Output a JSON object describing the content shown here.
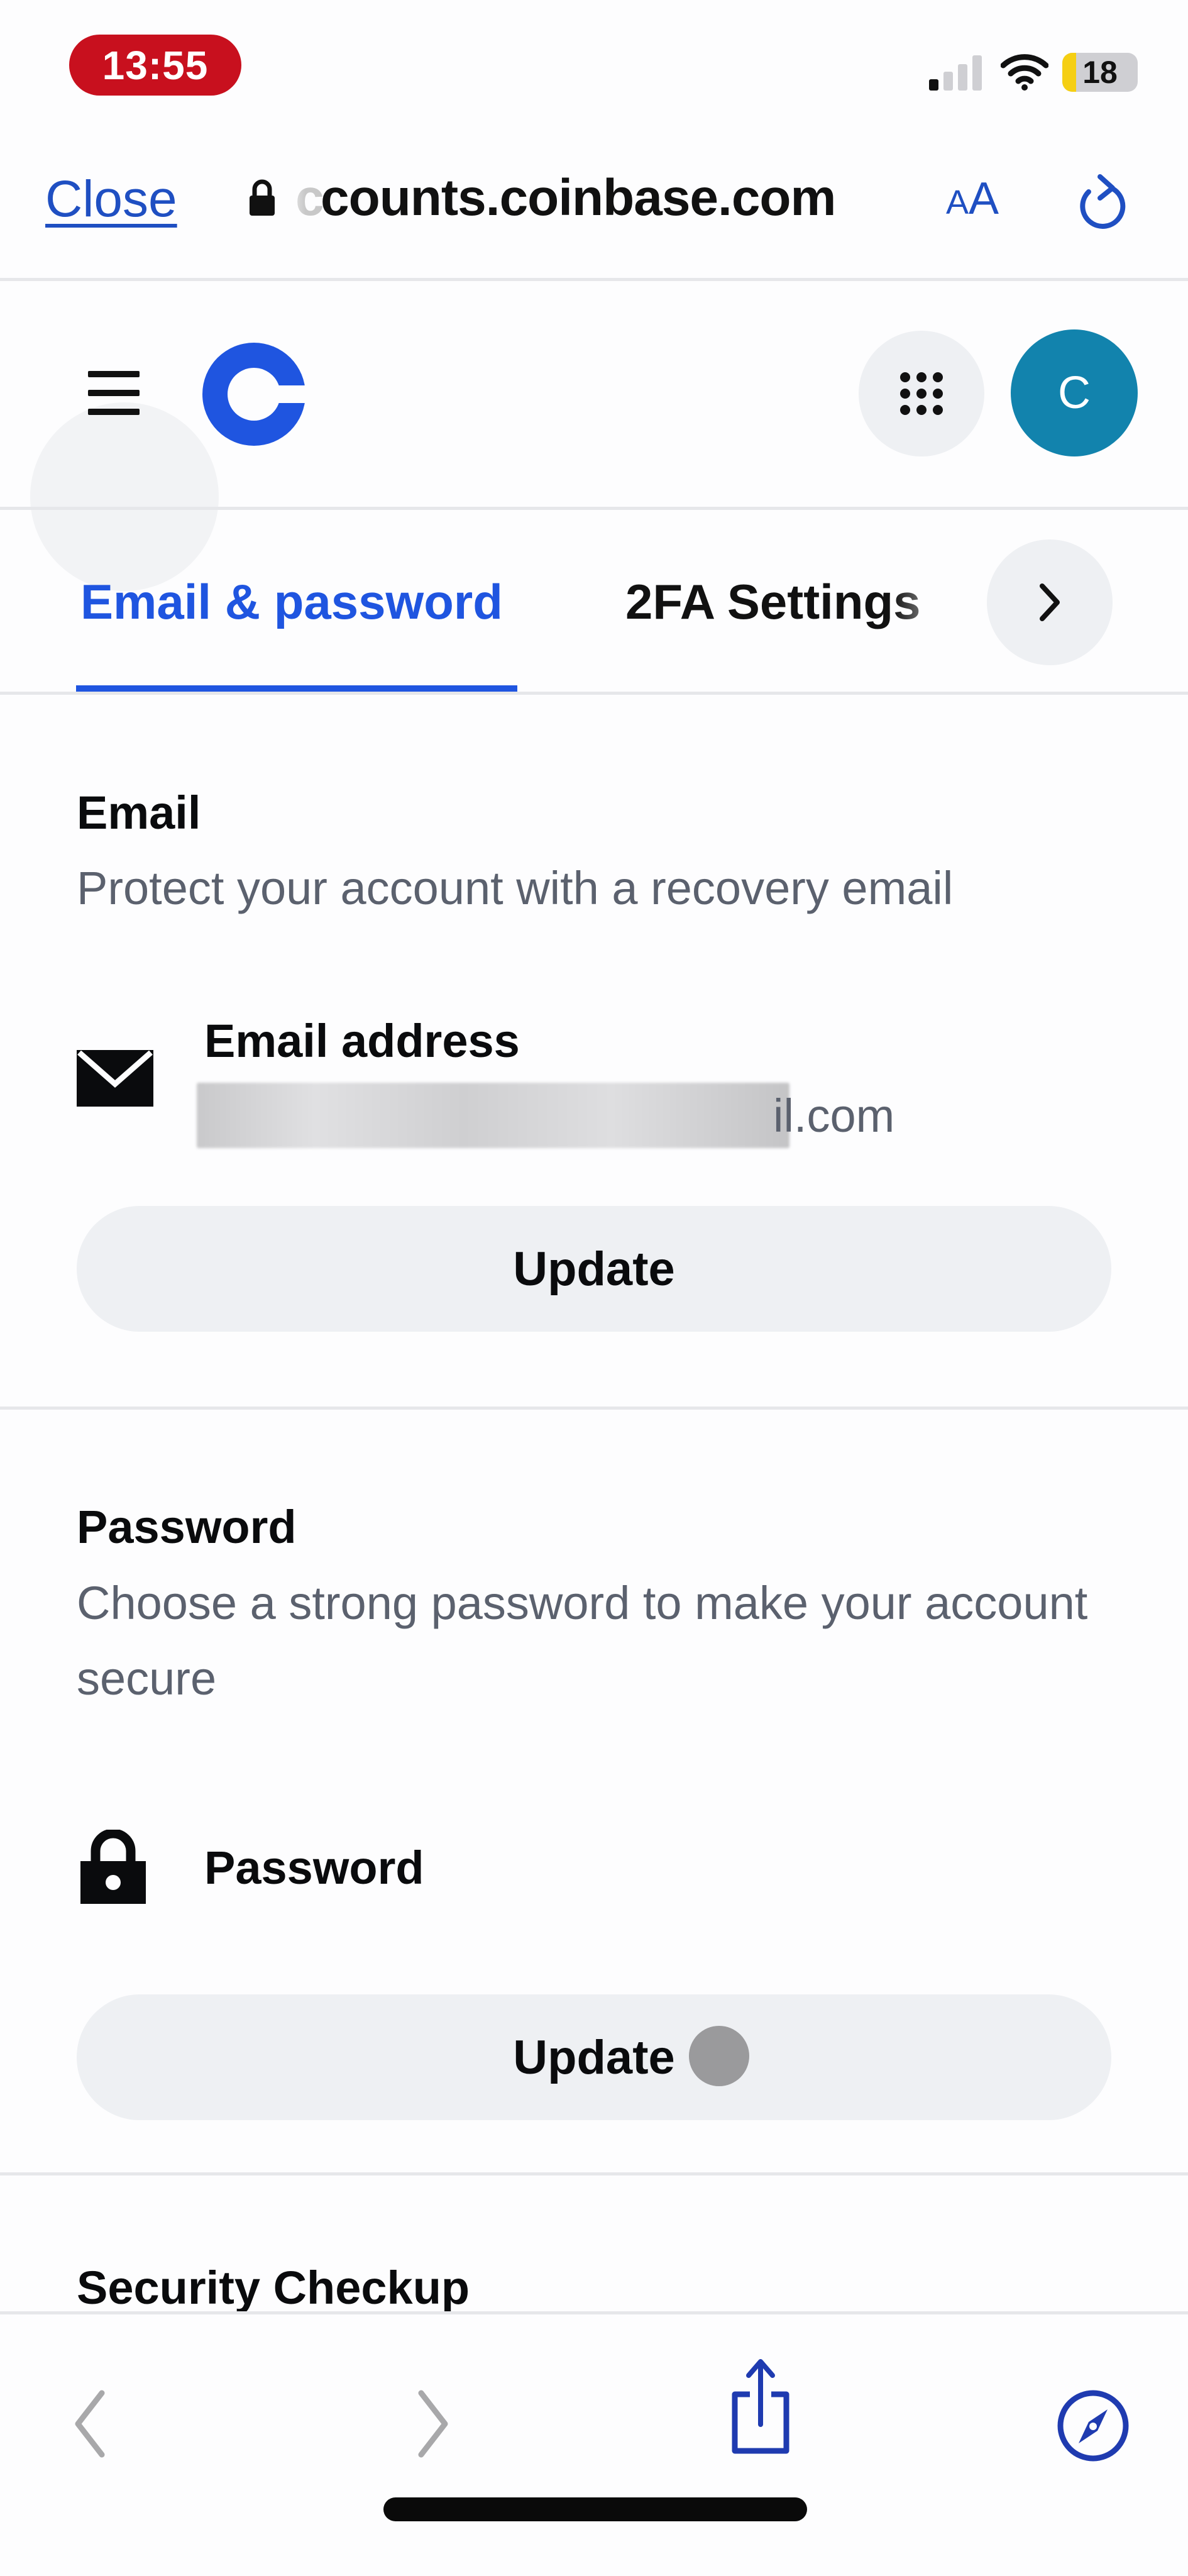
{
  "status_bar": {
    "time": "13:55",
    "battery_level": "18",
    "signal_bars_active": 1,
    "signal_bars_total": 4,
    "battery_fraction": 0.18,
    "icons": [
      "signal-icon",
      "wifi-icon",
      "battery-icon"
    ]
  },
  "browser": {
    "close_label": "Close",
    "url": "⁠ccounts.coinbase.com",
    "url_display": "counts.coinbase.com",
    "text_size_label_small": "A",
    "text_size_label_large": "A",
    "icons": [
      "lock-icon",
      "text-size-icon",
      "reload-icon"
    ]
  },
  "app_header": {
    "logo": "coinbase-logo",
    "avatar_initial": "C",
    "icons": [
      "menu-icon",
      "apps-grid-icon"
    ]
  },
  "tabs": [
    {
      "label": "Email & password",
      "active": true
    },
    {
      "label": "2FA Settings",
      "active": false
    }
  ],
  "email_section": {
    "title": "Email",
    "description": "Protect your account with a recovery email",
    "item_label": "Email address",
    "item_value_visible": "il.com",
    "update_label": "Update"
  },
  "password_section": {
    "title": "Password",
    "description": "Choose a strong password to make your account secure",
    "item_label": "Password",
    "update_label": "Update"
  },
  "security_section": {
    "title": "Security Checkup"
  },
  "toolbar": {
    "icons": [
      "back-icon",
      "forward-icon",
      "share-icon",
      "compass-icon"
    ],
    "back_enabled": false,
    "forward_enabled": false
  },
  "colors": {
    "brand_blue": "#1f55e0",
    "link_blue": "#1f4fc2",
    "avatar_teal": "#1283ad",
    "recording_red": "#c8101e",
    "button_gray": "#eef0f3",
    "secondary_text": "#5b616e"
  }
}
